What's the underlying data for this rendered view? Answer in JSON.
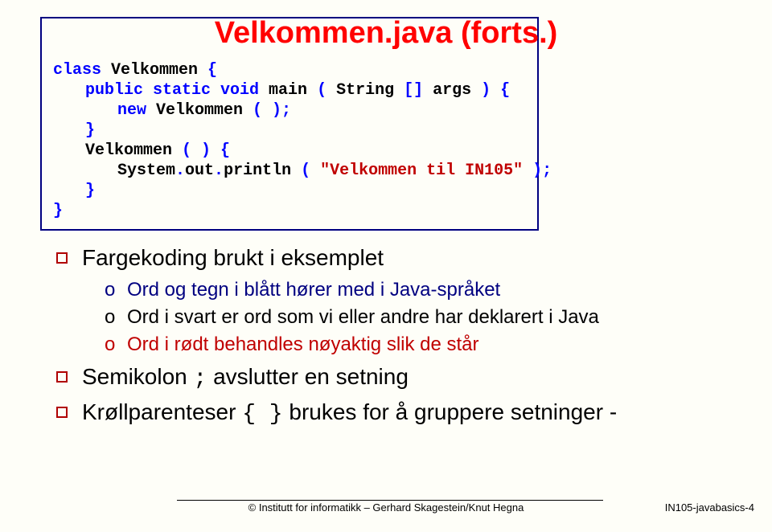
{
  "title": "Velkommen.java (forts.)",
  "code": {
    "l1": {
      "kw1": "class",
      "id1": " Velkommen ",
      "kw2": "{"
    },
    "l2": {
      "kw1": "public static void",
      "id1": " main ",
      "kw2": "(",
      "id2": " String ",
      "kw3": "[]",
      "id3": " args ",
      "kw4": ") {"
    },
    "l3": {
      "kw1": "new",
      "id1": " Velkommen ",
      "kw2": "( );"
    },
    "l4": {
      "kw1": "}"
    },
    "l5": {
      "id1": "Velkommen ",
      "kw1": "( ) {"
    },
    "l6": {
      "id1": "System",
      "kw1": ".",
      "id2": "out",
      "kw2": ".",
      "id3": "println ",
      "kw3": "( ",
      "str": "\"Velkommen til IN105\"",
      "kw4": " );"
    },
    "l7": {
      "kw1": "}"
    },
    "l8": {
      "kw1": "}"
    }
  },
  "bullets": {
    "b1": {
      "text": "Fargekoding brukt i eksemplet",
      "sub": [
        {
          "cls": "",
          "text": "Ord og tegn i blått hører med i Java-språket"
        },
        {
          "cls": "black",
          "text": "Ord i svart er ord som vi eller andre har deklarert i Java"
        },
        {
          "cls": "red",
          "text": "Ord i rødt behandles nøyaktig slik de står"
        }
      ]
    },
    "b2": {
      "pre": "Semikolon ",
      "mono": ";",
      "post": " avslutter en setning"
    },
    "b3": {
      "pre": "Krøllparenteser ",
      "mono": "{   }",
      "post": " brukes for å gruppere setninger -"
    }
  },
  "footer": {
    "credit": "© Institutt for informatikk – Gerhard Skagestein/Knut Hegna",
    "pagecode": "IN105-javabasics-4"
  }
}
